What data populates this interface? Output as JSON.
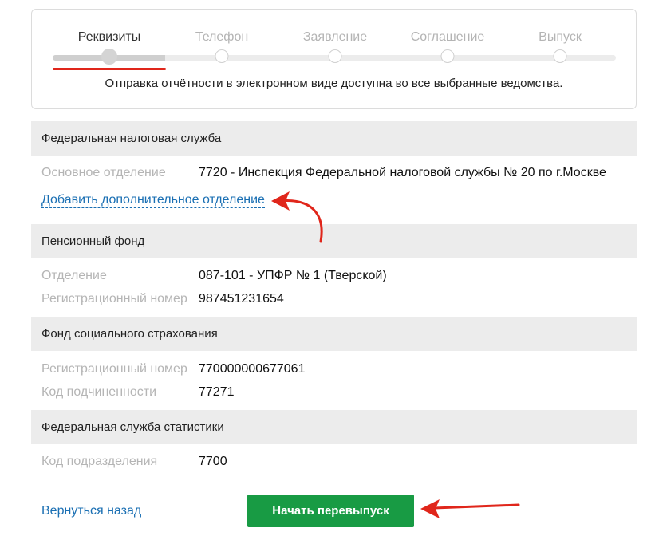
{
  "stepper": {
    "steps": [
      {
        "label": "Реквизиты",
        "active": true
      },
      {
        "label": "Телефон",
        "active": false
      },
      {
        "label": "Заявление",
        "active": false
      },
      {
        "label": "Соглашение",
        "active": false
      },
      {
        "label": "Выпуск",
        "active": false
      }
    ],
    "note": "Отправка отчётности в электронном виде доступна во все выбранные ведомства."
  },
  "fns": {
    "title": "Федеральная налоговая служба",
    "rows": [
      {
        "label": "Основное отделение",
        "value": "7720 - Инспекция Федеральной налоговой службы № 20 по г.Москве"
      }
    ],
    "add_link": "Добавить дополнительное отделение"
  },
  "pfr": {
    "title": "Пенсионный фонд",
    "rows": [
      {
        "label": "Отделение",
        "value": "087-101 - УПФР № 1 (Тверской)"
      },
      {
        "label": "Регистрационный номер",
        "value": "987451231654"
      }
    ]
  },
  "fss": {
    "title": "Фонд социального страхования",
    "rows": [
      {
        "label": "Регистрационный номер",
        "value": "770000000677061"
      },
      {
        "label": "Код подчиненности",
        "value": "77271"
      }
    ]
  },
  "rosstat": {
    "title": "Федеральная служба статистики",
    "rows": [
      {
        "label": "Код подразделения",
        "value": "7700"
      }
    ]
  },
  "footer": {
    "back_link": "Вернуться назад",
    "primary_button": "Начать перевыпуск"
  },
  "colors": {
    "accent_green": "#189b44",
    "link_blue": "#1a6fb3",
    "annotation_red": "#e0261b"
  }
}
